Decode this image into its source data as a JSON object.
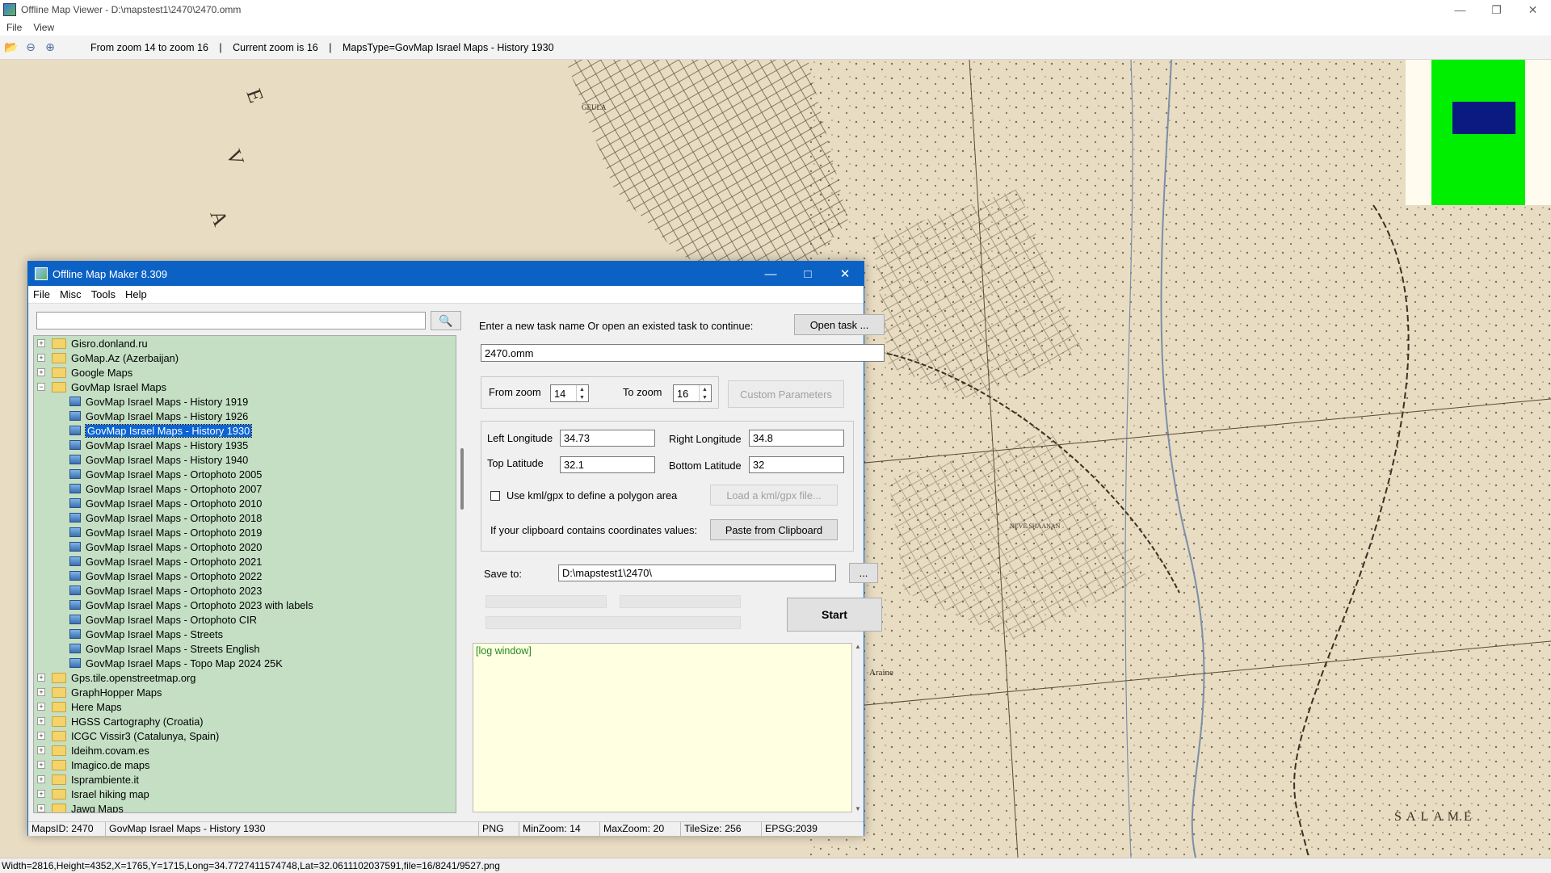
{
  "viewer": {
    "title": "Offline Map Viewer - D:\\mapstest1\\2470\\2470.omm",
    "menu": [
      "File",
      "View"
    ],
    "toolbar": {
      "zoom_range": "From zoom 14 to zoom 16",
      "sep1": "|",
      "current_zoom": "Current zoom is 16",
      "sep2": "|",
      "maps_type": "MapsType=GovMap Israel Maps - History 1930"
    },
    "status": "Width=2816,Height=4352,X=1765,Y=1715,Long=34.7727411574748,Lat=32.0611102037591,file=16/8241/9527.png",
    "map_labels": [
      "SALAME",
      "Araine",
      "GEULA",
      "NEVE SHAANAN"
    ]
  },
  "dialog": {
    "title": "Offline Map Maker 8.309",
    "menu": [
      "File",
      "Misc",
      "Tools",
      "Help"
    ],
    "search_value": "",
    "tree": [
      {
        "label": "Gisro.donland.ru",
        "type": "folder",
        "exp": "+"
      },
      {
        "label": "GoMap.Az (Azerbaijan)",
        "type": "folder",
        "exp": "+"
      },
      {
        "label": "Google Maps",
        "type": "folder",
        "exp": "+"
      },
      {
        "label": "GovMap Israel Maps",
        "type": "folder",
        "exp": "−"
      },
      {
        "label": "GovMap Israel Maps - History 1919",
        "type": "map"
      },
      {
        "label": "GovMap Israel Maps - History 1926",
        "type": "map"
      },
      {
        "label": "GovMap Israel Maps - History 1930",
        "type": "map",
        "selected": true
      },
      {
        "label": "GovMap Israel Maps - History 1935",
        "type": "map"
      },
      {
        "label": "GovMap Israel Maps - History 1940",
        "type": "map"
      },
      {
        "label": "GovMap Israel Maps - Ortophoto 2005",
        "type": "map"
      },
      {
        "label": "GovMap Israel Maps - Ortophoto 2007",
        "type": "map"
      },
      {
        "label": "GovMap Israel Maps - Ortophoto 2010",
        "type": "map"
      },
      {
        "label": "GovMap Israel Maps - Ortophoto 2018",
        "type": "map"
      },
      {
        "label": "GovMap Israel Maps - Ortophoto 2019",
        "type": "map"
      },
      {
        "label": "GovMap Israel Maps - Ortophoto 2020",
        "type": "map"
      },
      {
        "label": "GovMap Israel Maps - Ortophoto 2021",
        "type": "map"
      },
      {
        "label": "GovMap Israel Maps - Ortophoto 2022",
        "type": "map"
      },
      {
        "label": "GovMap Israel Maps - Ortophoto 2023",
        "type": "map"
      },
      {
        "label": "GovMap Israel Maps - Ortophoto 2023 with labels",
        "type": "map"
      },
      {
        "label": "GovMap Israel Maps - Ortophoto CIR",
        "type": "map"
      },
      {
        "label": "GovMap Israel Maps - Streets",
        "type": "map"
      },
      {
        "label": "GovMap Israel Maps - Streets English",
        "type": "map"
      },
      {
        "label": "GovMap Israel Maps - Topo Map 2024 25K",
        "type": "map"
      },
      {
        "label": "Gps.tile.openstreetmap.org",
        "type": "folder",
        "exp": "+"
      },
      {
        "label": "GraphHopper Maps",
        "type": "folder",
        "exp": "+"
      },
      {
        "label": "Here Maps",
        "type": "folder",
        "exp": "+"
      },
      {
        "label": "HGSS Cartography (Croatia)",
        "type": "folder",
        "exp": "+"
      },
      {
        "label": "ICGC Vissir3 (Catalunya, Spain)",
        "type": "folder",
        "exp": "+"
      },
      {
        "label": "Ideihm.covam.es",
        "type": "folder",
        "exp": "+"
      },
      {
        "label": "Imagico.de maps",
        "type": "folder",
        "exp": "+"
      },
      {
        "label": "Isprambiente.it",
        "type": "folder",
        "exp": "+"
      },
      {
        "label": "Israel hiking map",
        "type": "folder",
        "exp": "+"
      },
      {
        "label": "Jawg Maps",
        "type": "folder",
        "exp": "+"
      }
    ],
    "task_prompt": "Enter a new task name Or open an existed task to continue:",
    "open_task_label": "Open task ...",
    "task_name": "2470.omm",
    "from_zoom_label": "From zoom",
    "from_zoom": "14",
    "to_zoom_label": "To zoom",
    "to_zoom": "16",
    "custom_params_label": "Custom Parameters",
    "left_long_label": "Left Longitude",
    "left_long": "34.73",
    "right_long_label": "Right Longitude",
    "right_long": "34.8",
    "top_lat_label": "Top Latitude",
    "top_lat": "32.1",
    "bottom_lat_label": "Bottom Latitude",
    "bottom_lat": "32",
    "kml_checkbox_label": "Use kml/gpx to define a polygon area",
    "load_kml_label": "Load a kml/gpx file...",
    "clipboard_prompt": "If your clipboard contains coordinates values:",
    "paste_label": "Paste from Clipboard",
    "save_to_label": "Save to:",
    "save_to": "D:\\mapstest1\\2470\\",
    "browse_label": "...",
    "start_label": "Start",
    "log_label": "[log window]",
    "status": {
      "maps_id": "MapsID: 2470",
      "map_name": "GovMap Israel Maps - History 1930",
      "format": "PNG",
      "min_zoom": "MinZoom: 14",
      "max_zoom": "MaxZoom: 20",
      "tile_size": "TileSize: 256",
      "epsg": "EPSG:2039"
    }
  },
  "colors": {
    "map_paper": "#e8dcc2",
    "dialog_title": "#0b62c4",
    "tree_bg": "#c4dfc4",
    "log_bg": "#ffffe1",
    "minimap_green": "#00ee00",
    "minimap_blue": "#0a1a80"
  }
}
